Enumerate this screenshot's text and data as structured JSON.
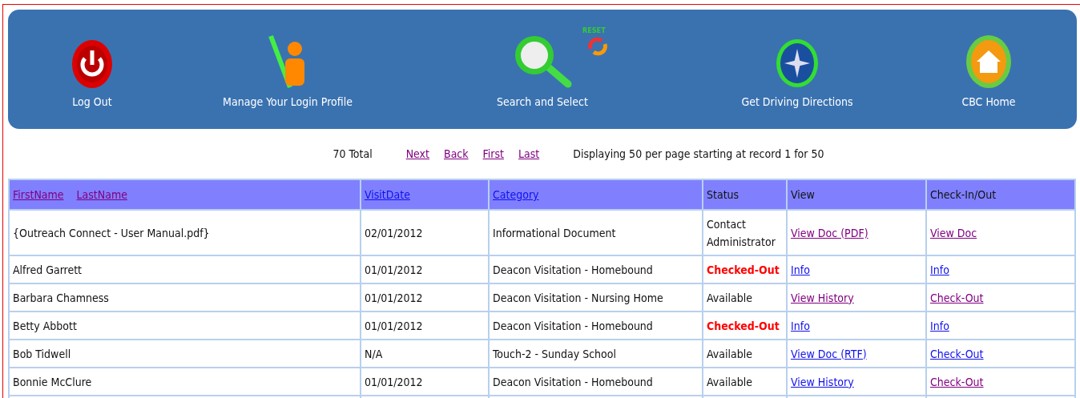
{
  "nav": [
    {
      "kind": "power",
      "label": "Log Out"
    },
    {
      "kind": "profile",
      "label": "Manage Your Login Profile"
    },
    {
      "kind": "search",
      "label": "Search and Select",
      "badge": "RESET"
    },
    {
      "kind": "compass",
      "label": "Get Driving Directions"
    },
    {
      "kind": "home",
      "label": "CBC Home"
    }
  ],
  "pager": {
    "total": "70 Total",
    "links": [
      {
        "label": "Next",
        "visited": true
      },
      {
        "label": "Back",
        "visited": true
      },
      {
        "label": "First",
        "visited": true
      },
      {
        "label": "Last",
        "visited": true
      }
    ],
    "summary": "Displaying 50 per page starting at record 1 for 50"
  },
  "table": {
    "columns": [
      {
        "links": [
          {
            "label": "FirstName",
            "visited": true
          },
          {
            "label": "LastName",
            "visited": true
          }
        ]
      },
      {
        "links": [
          {
            "label": "VisitDate",
            "visited": false
          }
        ]
      },
      {
        "links": [
          {
            "label": "Category",
            "visited": false
          }
        ]
      },
      {
        "label": "Status"
      },
      {
        "label": "View"
      },
      {
        "label": "Check-In/Out"
      }
    ],
    "rows": [
      {
        "name": "{Outreach Connect - User Manual.pdf}",
        "date": "02/01/2012",
        "category": "Informational Document",
        "status": {
          "text": "Contact Administrator",
          "kind": "normal"
        },
        "view": {
          "label": "View Doc (PDF)",
          "visited": true
        },
        "check": {
          "label": "View Doc",
          "visited": true
        }
      },
      {
        "name": "Alfred Garrett",
        "date": "01/01/2012",
        "category": "Deacon Visitation - Homebound",
        "status": {
          "text": "Checked-Out",
          "kind": "alert"
        },
        "view": {
          "label": "Info",
          "visited": false
        },
        "check": {
          "label": "Info",
          "visited": false
        }
      },
      {
        "name": "Barbara Chamness",
        "date": "01/01/2012",
        "category": "Deacon Visitation - Nursing Home",
        "status": {
          "text": "Available",
          "kind": "normal"
        },
        "view": {
          "label": "View History",
          "visited": true
        },
        "check": {
          "label": "Check-Out",
          "visited": true
        }
      },
      {
        "name": "Betty Abbott",
        "date": "01/01/2012",
        "category": "Deacon Visitation - Homebound",
        "status": {
          "text": "Checked-Out",
          "kind": "alert"
        },
        "view": {
          "label": "Info",
          "visited": false
        },
        "check": {
          "label": "Info",
          "visited": false
        }
      },
      {
        "name": "Bob Tidwell",
        "date": "N/A",
        "category": "Touch-2 - Sunday School",
        "status": {
          "text": "Available",
          "kind": "normal"
        },
        "view": {
          "label": "View Doc (RTF)",
          "visited": false
        },
        "check": {
          "label": "Check-Out",
          "visited": false
        }
      },
      {
        "name": "Bonnie McClure",
        "date": "01/01/2012",
        "category": "Deacon Visitation - Homebound",
        "status": {
          "text": "Available",
          "kind": "normal"
        },
        "view": {
          "label": "View History",
          "visited": false
        },
        "check": {
          "label": "Check-Out",
          "visited": true
        }
      }
    ]
  }
}
